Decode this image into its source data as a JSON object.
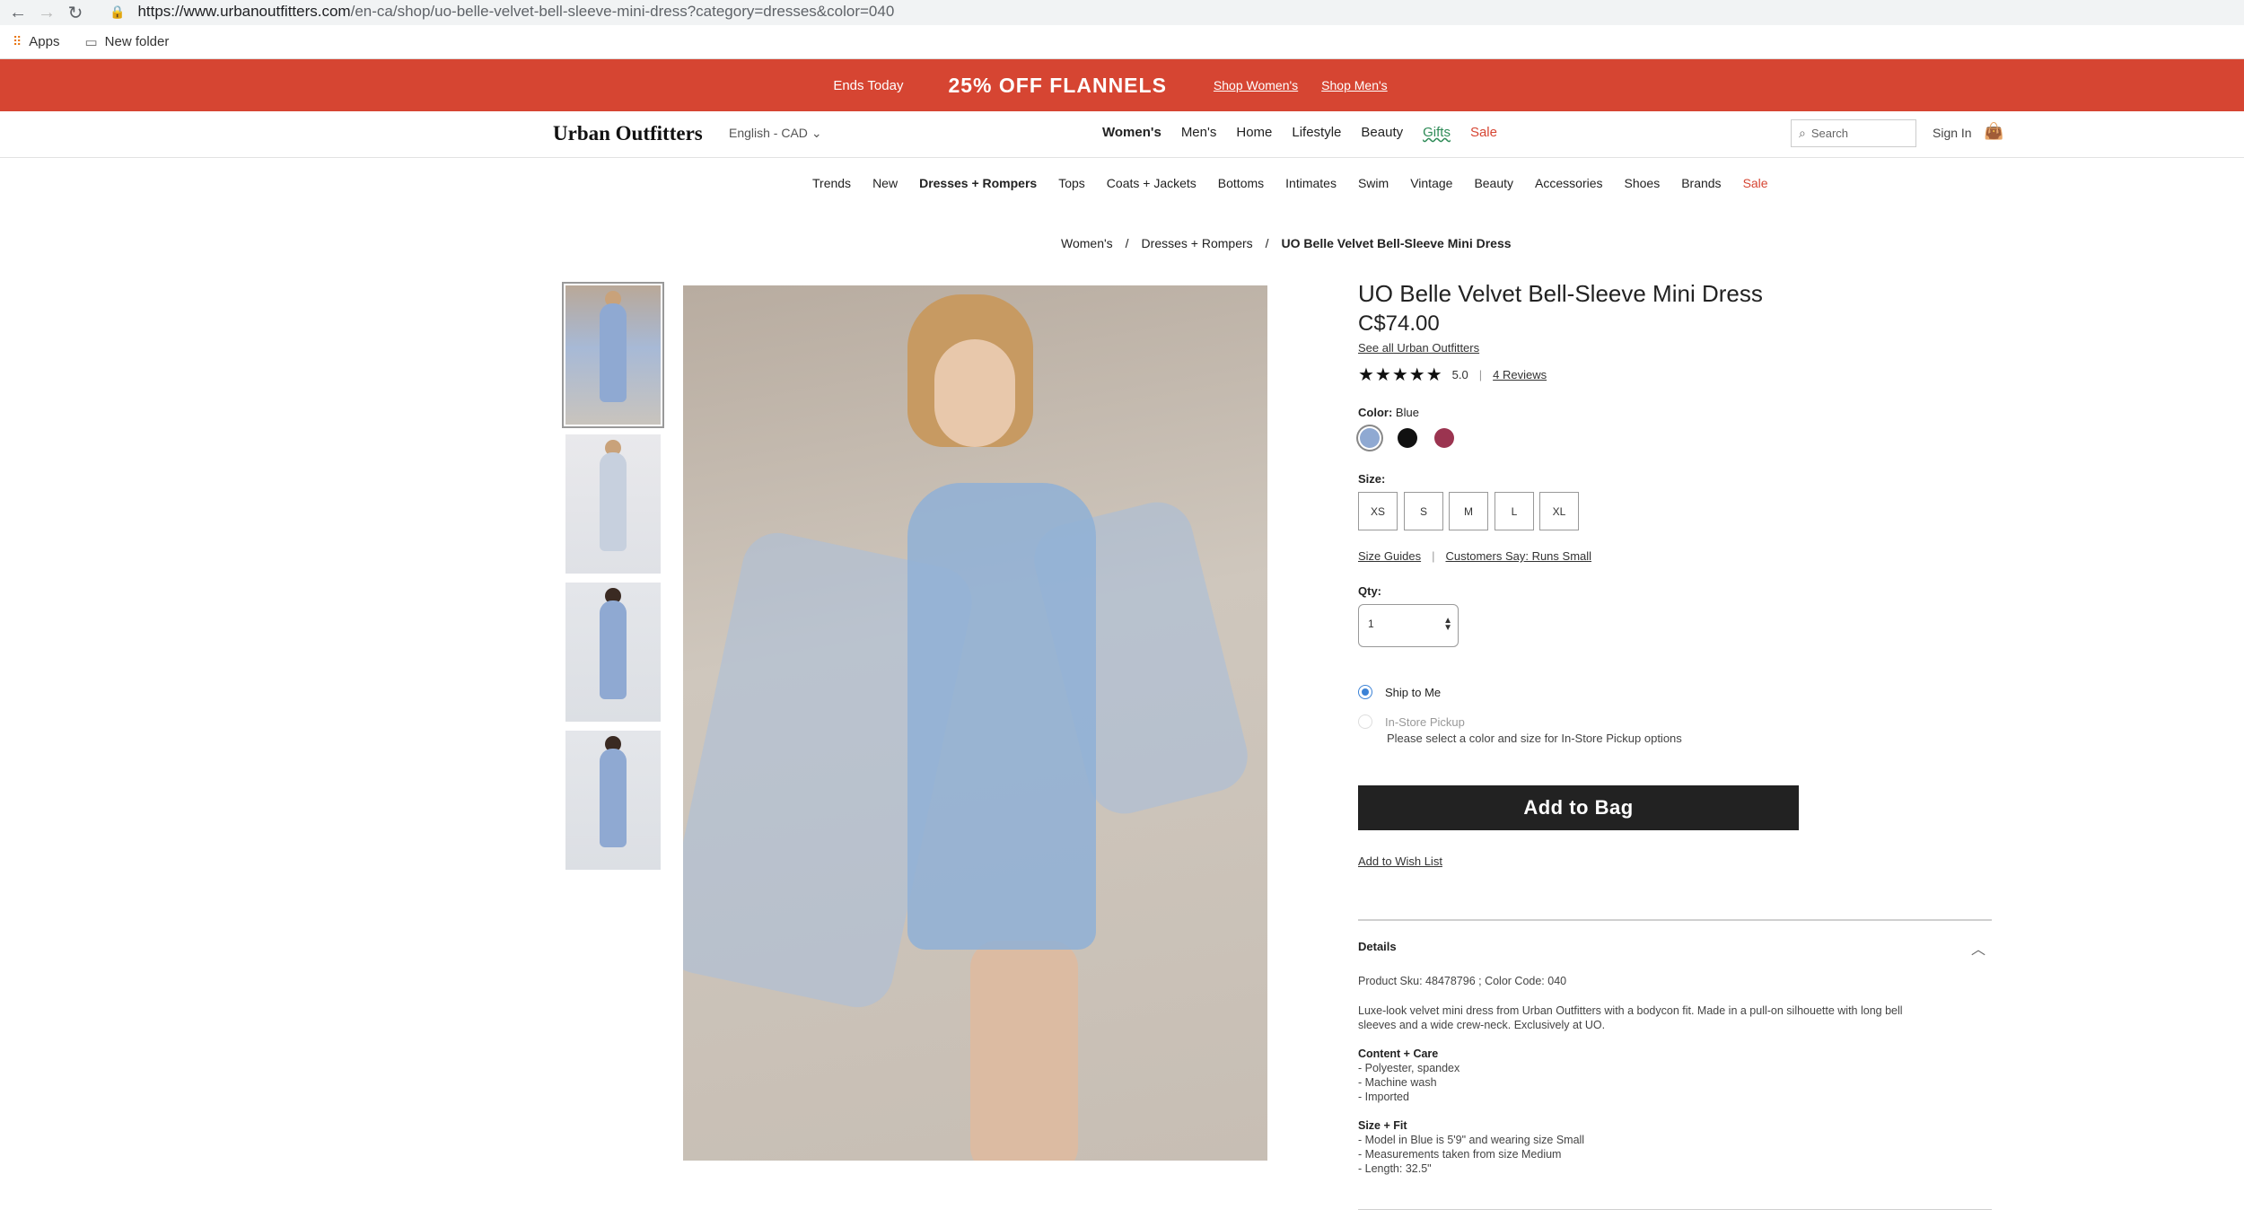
{
  "browser": {
    "url_host": "https://www.urbanoutfitters.com",
    "url_path": "/en-ca/shop/uo-belle-velvet-bell-sleeve-mini-dress?category=dresses&color=040",
    "bookmarks": [
      "Apps",
      "New folder"
    ]
  },
  "promo": {
    "ends": "Ends Today",
    "headline": "25% OFF FLANNELS",
    "link_women": "Shop Women's",
    "link_men": "Shop Men's"
  },
  "header": {
    "logo": "Urban Outfitters",
    "language": "English - CAD",
    "nav": [
      "Women's",
      "Men's",
      "Home",
      "Lifestyle",
      "Beauty",
      "Gifts",
      "Sale"
    ],
    "search_placeholder": "Search",
    "signin": "Sign In"
  },
  "subnav": [
    "Trends",
    "New",
    "Dresses + Rompers",
    "Tops",
    "Coats + Jackets",
    "Bottoms",
    "Intimates",
    "Swim",
    "Vintage",
    "Beauty",
    "Accessories",
    "Shoes",
    "Brands",
    "Sale"
  ],
  "breadcrumb": [
    "Women's",
    "Dresses + Rompers",
    "UO Belle Velvet Bell-Sleeve Mini Dress"
  ],
  "product": {
    "title": "UO Belle Velvet Bell-Sleeve Mini Dress",
    "price": "C$74.00",
    "see_all": "See all Urban Outfitters",
    "stars": "★★★★★",
    "rating": "5.0",
    "reviews": "4 Reviews",
    "color_label": "Color:",
    "color_value": "Blue",
    "swatches": [
      "#8fa9d2",
      "#111111",
      "#9b3450"
    ],
    "size_label": "Size:",
    "sizes": [
      "XS",
      "S",
      "M",
      "L",
      "XL"
    ],
    "size_guides": "Size Guides",
    "runs_small": "Customers Say: Runs Small",
    "qty_label": "Qty:",
    "qty_value": "1",
    "ship_to_me": "Ship to Me",
    "instore": "In-Store Pickup",
    "instore_note": "Please select a color and size for In-Store Pickup options",
    "add_to_bag": "Add to Bag",
    "wish_list": "Add to Wish List"
  },
  "details": {
    "heading": "Details",
    "sku": "Product Sku: 48478796 ; Color Code: 040",
    "desc1": "Luxe-look velvet mini dress from Urban Outfitters with a bodycon fit. Made in a pull-on silhouette with long bell",
    "desc2": "sleeves and a wide crew-neck. Exclusively at UO.",
    "care_heading": "Content + Care",
    "care": [
      "- Polyester, spandex",
      "- Machine wash",
      "- Imported"
    ],
    "fit_heading": "Size + Fit",
    "fit": [
      "- Model in Blue is 5'9\" and wearing size Small",
      "- Measurements taken from size Medium",
      "- Length: 32.5\""
    ]
  }
}
